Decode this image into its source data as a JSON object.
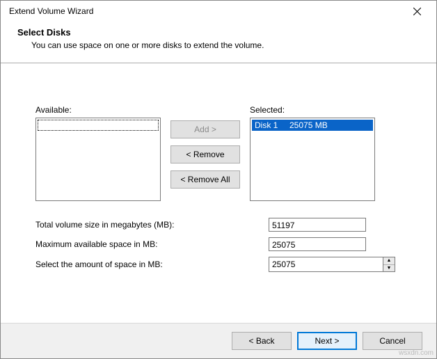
{
  "window": {
    "title": "Extend Volume Wizard"
  },
  "header": {
    "title": "Select Disks",
    "subtitle": "You can use space on one or more disks to extend the volume."
  },
  "picker": {
    "available_label": "Available:",
    "selected_label": "Selected:",
    "selected_items": [
      {
        "text": "Disk 1     25075 MB"
      }
    ],
    "add_label": "Add >",
    "remove_label": "< Remove",
    "remove_all_label": "< Remove All"
  },
  "fields": {
    "total_label": "Total volume size in megabytes (MB):",
    "total_value": "51197",
    "max_label": "Maximum available space in MB:",
    "max_value": "25075",
    "select_label": "Select the amount of space in MB:",
    "select_value": "25075"
  },
  "footer": {
    "back": "< Back",
    "next": "Next >",
    "cancel": "Cancel"
  },
  "watermark": "wsxdn.com"
}
